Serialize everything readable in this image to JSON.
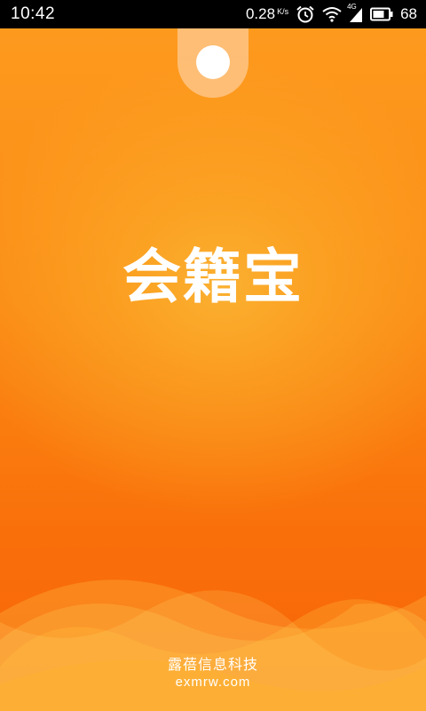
{
  "status_bar": {
    "time": "10:42",
    "net_speed": "0.28",
    "net_speed_unit": "K/s",
    "network_type": "4G",
    "battery": "68",
    "icons": [
      "alarm-icon",
      "wifi-icon",
      "cellular-signal-icon",
      "battery-icon"
    ]
  },
  "splash": {
    "logo_text": "会籍宝",
    "company_name": "露蓓信息科技",
    "company_url": "exmrw.com"
  },
  "colors": {
    "background_top": "#fd9a1e",
    "background_bottom": "#f86508",
    "glow": "#fbb030",
    "text": "#ffffff"
  }
}
